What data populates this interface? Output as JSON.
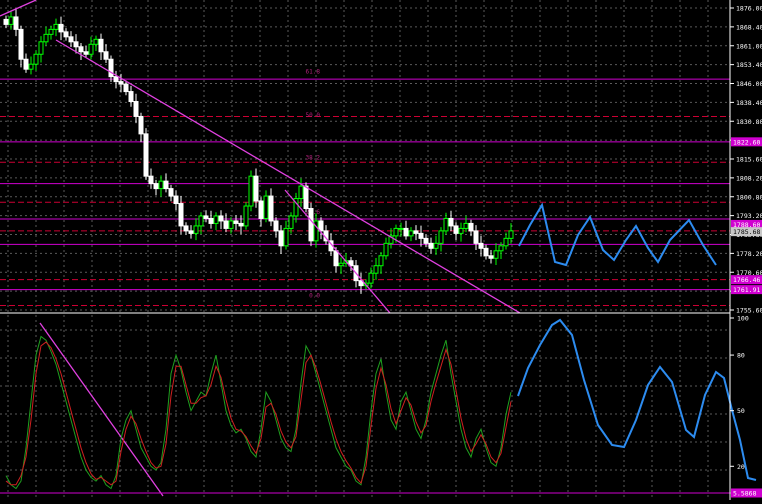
{
  "chart_data": [
    {
      "type": "candlestick",
      "title": "",
      "colors": {
        "bull": "#00ff00",
        "bear": "#ffffff",
        "forecast": "#2d8cf0",
        "trendline": "#e040e0",
        "level": "#d000d0",
        "fib": "#b0207a",
        "grid": "#5a5a5a",
        "axis_text": "#ffffff"
      },
      "y_ticks": [
        "1876.00",
        "1868.40",
        "1861.00",
        "1853.40",
        "1846.00",
        "1838.40",
        "1830.80",
        "1823.20",
        "1815.60",
        "1808.20",
        "1800.80",
        "1793.20",
        "1785.80",
        "1778.20",
        "1770.60",
        "1763.00",
        "1755.60"
      ],
      "ylim": [
        1753,
        1878
      ],
      "price_labels": [
        {
          "text": "1822.60",
          "value": 1821.8
        },
        {
          "text": "1788.60",
          "value": 1788.6
        },
        {
          "text": "1785.68",
          "value": 1785.7
        },
        {
          "text": "1766.46",
          "value": 1766.4
        },
        {
          "text": "1761.91",
          "value": 1762.4
        }
      ],
      "fib_labels": [
        {
          "text": "61.8",
          "value": 1848.5
        },
        {
          "text": "50.0",
          "value": 1831.0
        },
        {
          "text": "38.2",
          "value": 1813.8
        },
        {
          "text": "23.6",
          "value": 1792.0
        },
        {
          "text": "0.0",
          "value": 1758.5
        }
      ],
      "levels": [
        1847.0,
        1832.0,
        1821.8,
        1813.6,
        1805.0,
        1797.5,
        1790.8,
        1786.0,
        1780.6,
        1766.4,
        1762.4,
        1756.0
      ],
      "closes": [
        1869,
        1872,
        1867,
        1855,
        1851,
        1853,
        1857,
        1862,
        1865,
        1867,
        1869,
        1866,
        1864,
        1862,
        1860,
        1858,
        1857,
        1861,
        1863,
        1858,
        1855,
        1848,
        1846,
        1845,
        1842,
        1838,
        1832,
        1825,
        1808,
        1805,
        1803,
        1806,
        1803,
        1800,
        1797,
        1788,
        1786,
        1785,
        1788,
        1792,
        1791,
        1789,
        1792,
        1790,
        1787,
        1790,
        1789,
        1788,
        1796,
        1808,
        1798,
        1791,
        1800,
        1790,
        1786,
        1780,
        1787,
        1792,
        1799,
        1804,
        1795,
        1782,
        1790,
        1786,
        1782,
        1778,
        1772,
        1773,
        1774,
        1772,
        1766,
        1764,
        1765,
        1769,
        1772,
        1776,
        1781,
        1784,
        1787,
        1787,
        1784,
        1786,
        1785,
        1783,
        1781,
        1779,
        1781,
        1786,
        1791,
        1788,
        1785,
        1787,
        1789,
        1786,
        1781,
        1779,
        1776,
        1775,
        1778,
        1780,
        1783,
        1786
      ]
    },
    {
      "type": "line",
      "title": "",
      "ylim": [
        0,
        100
      ],
      "y_ticks": [
        "100",
        "80",
        "50",
        "20"
      ],
      "level_label": "5.5868",
      "level_value": 5.6,
      "series": [
        {
          "values": [
            15,
            10,
            8,
            12,
            30,
            55,
            80,
            90,
            88,
            82,
            75,
            65,
            55,
            45,
            35,
            25,
            18,
            14,
            12,
            15,
            10,
            8,
            15,
            35,
            45,
            50,
            40,
            30,
            25,
            20,
            18,
            22,
            40,
            70,
            80,
            72,
            60,
            50,
            55,
            60,
            58,
            70,
            80,
            65,
            50,
            42,
            38,
            40,
            35,
            28,
            25,
            40,
            60,
            55,
            45,
            35,
            30,
            28,
            40,
            65,
            85,
            80,
            70,
            60,
            50,
            40,
            30,
            25,
            20,
            18,
            12,
            10,
            25,
            50,
            70,
            78,
            60,
            45,
            40,
            55,
            60,
            50,
            40,
            35,
            45,
            60,
            70,
            80,
            88,
            70,
            55,
            40,
            30,
            25,
            35,
            40,
            30,
            22,
            20,
            30,
            48,
            60
          ]
        },
        {
          "values": [
            12,
            10,
            10,
            15,
            25,
            45,
            70,
            85,
            87,
            84,
            78,
            70,
            60,
            50,
            40,
            30,
            22,
            16,
            13,
            14,
            12,
            10,
            12,
            28,
            40,
            47,
            43,
            35,
            28,
            22,
            19,
            20,
            32,
            58,
            74,
            74,
            64,
            54,
            54,
            57,
            58,
            64,
            74,
            68,
            56,
            46,
            40,
            39,
            36,
            31,
            27,
            35,
            52,
            54,
            48,
            39,
            33,
            30,
            36,
            56,
            76,
            80,
            73,
            64,
            54,
            44,
            35,
            28,
            23,
            19,
            14,
            11,
            20,
            42,
            62,
            73,
            64,
            51,
            43,
            50,
            57,
            53,
            44,
            38,
            42,
            55,
            65,
            74,
            83,
            75,
            61,
            46,
            35,
            28,
            32,
            37,
            32,
            25,
            22,
            27,
            41,
            55
          ]
        }
      ]
    }
  ]
}
